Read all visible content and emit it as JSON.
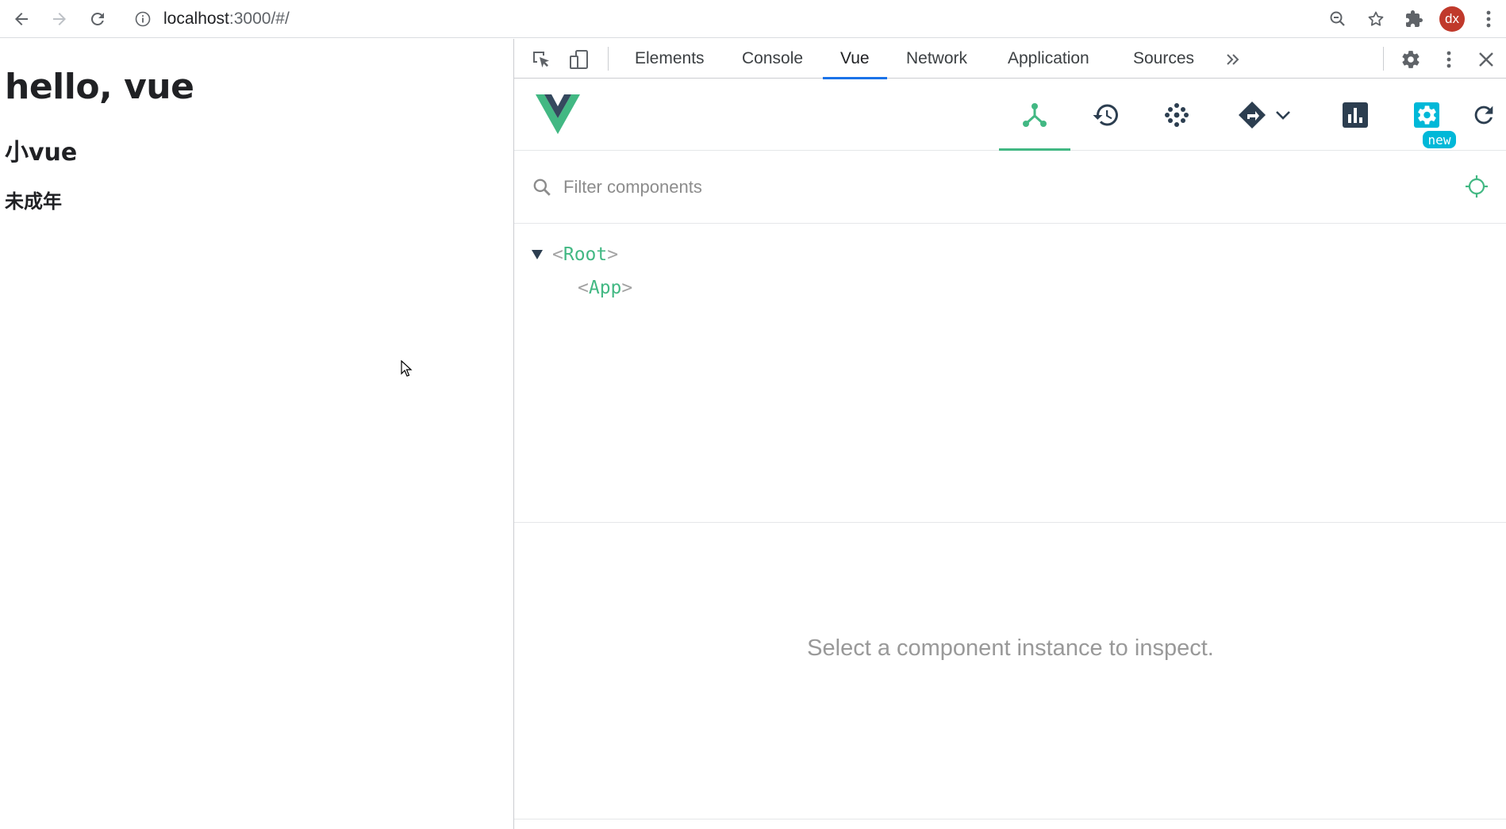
{
  "browser": {
    "url_host": "localhost",
    "url_path": ":3000/#/",
    "avatar_initials": "dx"
  },
  "page": {
    "heading1": "hello, vue",
    "heading2": "小vue",
    "heading3": "未成年"
  },
  "devtools": {
    "tabs": [
      {
        "label": "Elements"
      },
      {
        "label": "Console"
      },
      {
        "label": "Vue"
      },
      {
        "label": "Network"
      },
      {
        "label": "Application"
      },
      {
        "label": "Sources"
      }
    ],
    "active_tab": "Vue",
    "vue": {
      "new_badge": "new",
      "filter_placeholder": "Filter components",
      "tree": [
        {
          "name": "Root"
        },
        {
          "name": "App"
        }
      ],
      "empty_message": "Select a component instance to inspect."
    }
  },
  "colors": {
    "vue_green": "#42b883",
    "vue_dark": "#35495e",
    "tab_active_underline": "#1a73e8",
    "badge_cyan": "#00b8d8",
    "avatar_bg": "#c0392b"
  }
}
